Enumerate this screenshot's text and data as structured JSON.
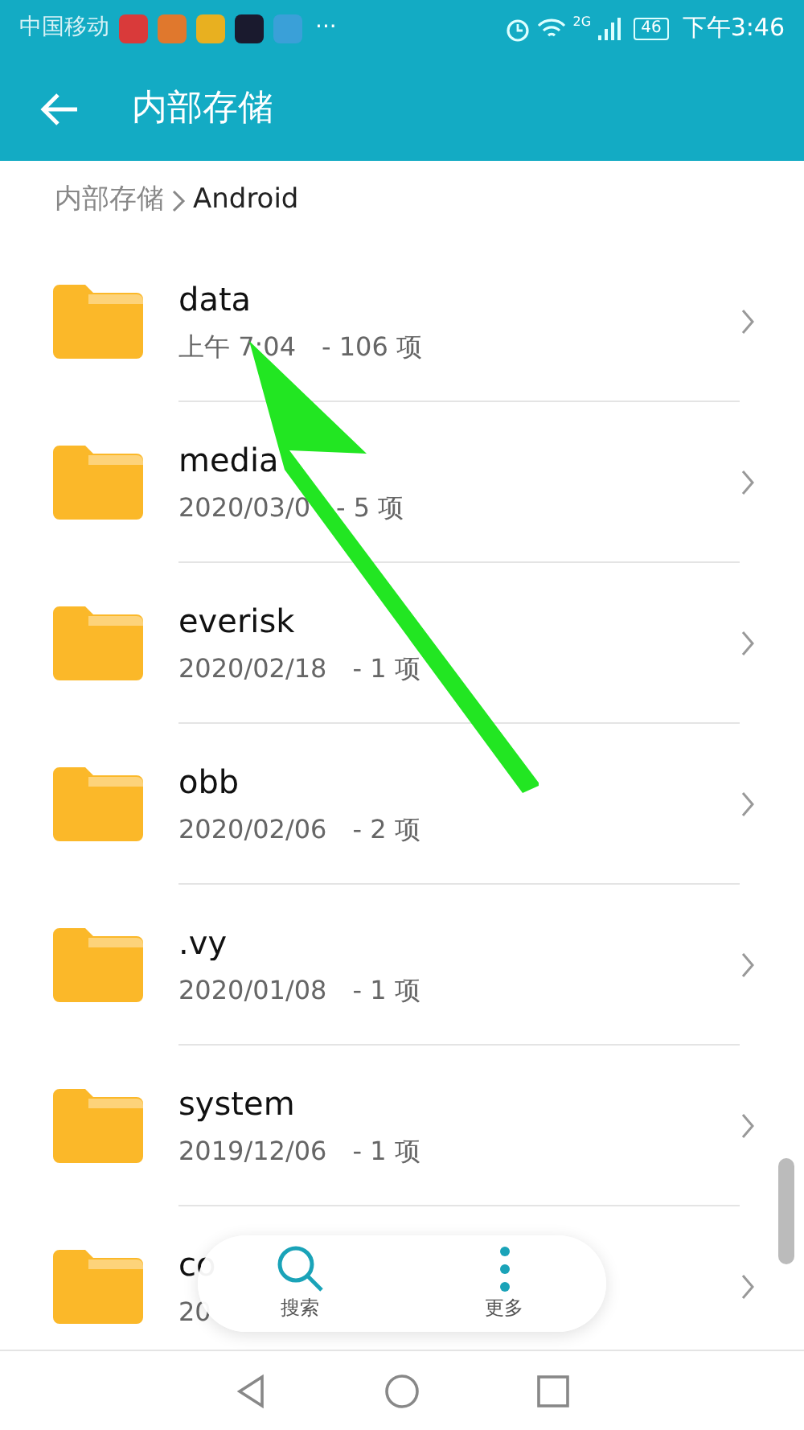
{
  "status_bar": {
    "carrier": "中国移动",
    "more": "···",
    "network": "2G",
    "battery": "46",
    "time": "下午3:46"
  },
  "header": {
    "title": "内部存储"
  },
  "breadcrumb": {
    "root": "内部存储",
    "current": "Android"
  },
  "folders": [
    {
      "name": "data",
      "date": "上午 7:04",
      "count": "- 106 项"
    },
    {
      "name": "media",
      "date": "2020/03/0",
      "count": "- 5 项"
    },
    {
      "name": "everisk",
      "date": "2020/02/18",
      "count": "- 1 项"
    },
    {
      "name": "obb",
      "date": "2020/02/06",
      "count": "- 2 项"
    },
    {
      "name": ".vy",
      "date": "2020/01/08",
      "count": "- 1 项"
    },
    {
      "name": "system",
      "date": "2019/12/06",
      "count": "- 1 项"
    },
    {
      "name": "co",
      "date": "20"
    }
  ],
  "toolbar": [
    {
      "kind": "search",
      "label": "搜索"
    },
    {
      "kind": "more",
      "label": "更多"
    }
  ]
}
